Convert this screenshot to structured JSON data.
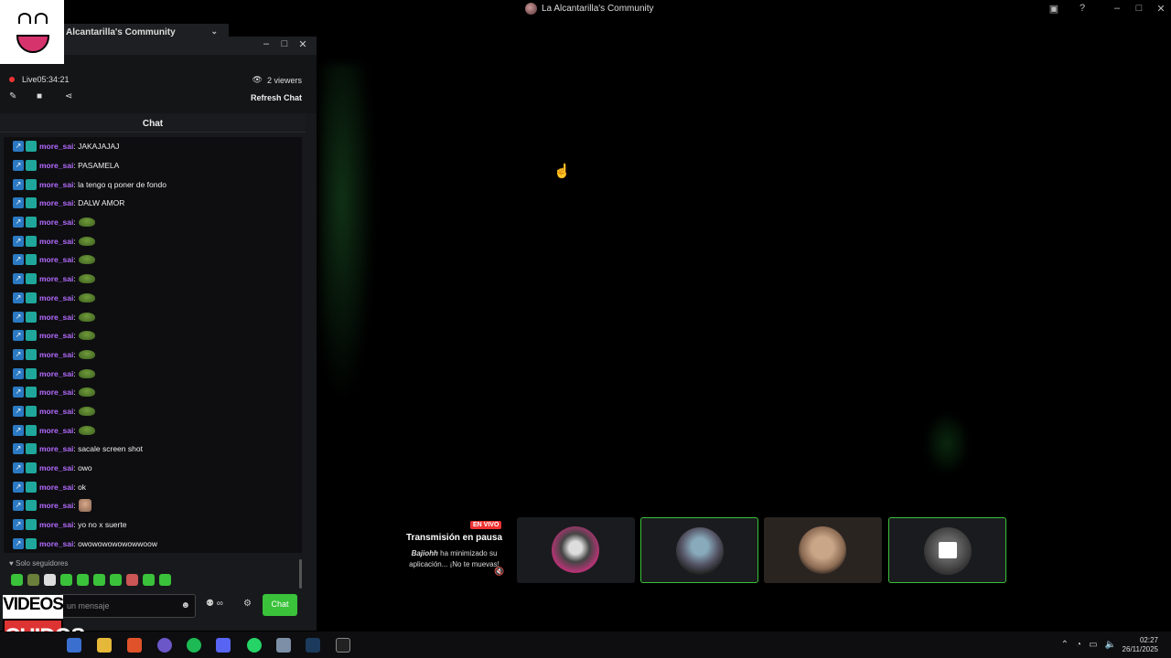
{
  "window": {
    "title": "La Alcantarilla's Community",
    "minimize_icon": "minimize-icon",
    "maximize_icon": "maximize-icon",
    "close_icon": "close-icon"
  },
  "server": {
    "name": "Alcantarilla's Community",
    "chevron": "⌄"
  },
  "stream": {
    "live_label": "Live",
    "uptime": "05:34:21",
    "viewers": "2 viewers",
    "refresh_label": "Refresh Chat"
  },
  "chat": {
    "header": "Chat",
    "messages": [
      {
        "user": "more_sai",
        "text": ": JAKAJAJAJ"
      },
      {
        "user": "more_sai",
        "text": ": PASAMELA"
      },
      {
        "user": "more_sai",
        "text": ": la tengo q poner de fondo"
      },
      {
        "user": "more_sai",
        "text": ": DALW AMOR"
      },
      {
        "user": "more_sai",
        "text": ":",
        "emote": "pepe"
      },
      {
        "user": "more_sai",
        "text": ":",
        "emote": "pepe"
      },
      {
        "user": "more_sai",
        "text": ":",
        "emote": "pepe"
      },
      {
        "user": "more_sai",
        "text": ":",
        "emote": "pepe"
      },
      {
        "user": "more_sai",
        "text": ":",
        "emote": "pepe"
      },
      {
        "user": "more_sai",
        "text": ":",
        "emote": "pepe"
      },
      {
        "user": "more_sai",
        "text": ":",
        "emote": "pepe"
      },
      {
        "user": "more_sai",
        "text": ":",
        "emote": "pepe"
      },
      {
        "user": "more_sai",
        "text": ":",
        "emote": "pepe"
      },
      {
        "user": "more_sai",
        "text": ":",
        "emote": "pepe"
      },
      {
        "user": "more_sai",
        "text": ":",
        "emote": "pepe"
      },
      {
        "user": "more_sai",
        "text": ":",
        "emote": "pepe"
      },
      {
        "user": "more_sai",
        "text": ": sacale screen shot"
      },
      {
        "user": "more_sai",
        "text": ": owo"
      },
      {
        "user": "more_sai",
        "text": ": ok"
      },
      {
        "user": "more_sai",
        "text": ":",
        "emote": "cat"
      },
      {
        "user": "more_sai",
        "text": ": yo no x suerte"
      },
      {
        "user": "more_sai",
        "text": ": owowowowowowwoow"
      }
    ],
    "followers_only": "Solo seguidores",
    "input_placeholder": "un mensaje",
    "send_label": "Chat",
    "points_label": "∞"
  },
  "overlay": {
    "logo_line1": "VIDEOS",
    "logo_line2": "CHIDOS"
  },
  "paused_tile": {
    "badge": "EN VIVO",
    "title": "Transmisión en pausa",
    "user": "Bajiohh",
    "desc": " ha minimizado su aplicación... ¡No te muevas!"
  },
  "clock": {
    "time": "02:27",
    "date": "26/11/2025"
  },
  "colors": {
    "accent_green": "#3ac23a",
    "username_purple": "#b36bff",
    "live_red": "#e33333"
  }
}
